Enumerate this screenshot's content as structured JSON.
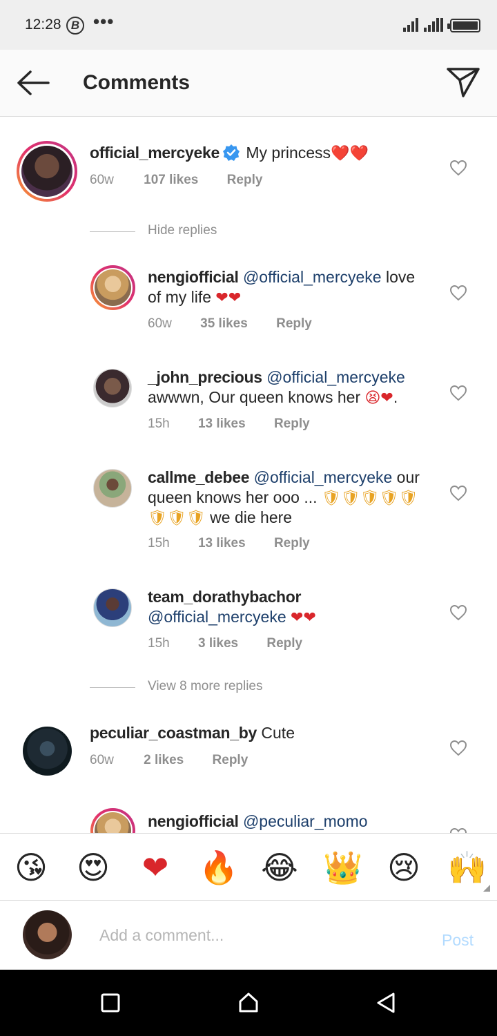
{
  "status_bar": {
    "time": "12:28",
    "b_icon": "B",
    "more_dots": "•••"
  },
  "header": {
    "title": "Comments",
    "back_icon": "arrow-left-icon",
    "send_icon": "paper-plane-icon"
  },
  "comments": [
    {
      "user": "official_mercyeke",
      "verified": true,
      "text": "My princess",
      "emojis": "❤️❤️",
      "time": "60w",
      "likes": "107 likes",
      "reply": "Reply"
    }
  ],
  "hide_replies_label": "Hide replies",
  "replies": [
    {
      "user": "nengiofficial",
      "mention": "@official_mercyeke",
      "text_line1_rest": " love",
      "text_line2": "of my life ",
      "emojis": "❤❤",
      "time": "60w",
      "likes": "35 likes",
      "reply": "Reply"
    },
    {
      "user": "_john_precious",
      "mention": "@official_mercyeke",
      "text_line2": "awwwn, Our queen knows her ",
      "emojis": "😫❤",
      "text_after": ".",
      "time": "15h",
      "likes": "13 likes",
      "reply": "Reply"
    },
    {
      "user": "callme_debee",
      "mention": "@official_mercyeke",
      "text_line1_rest": " our",
      "text_line2": "queen knows her ooo ... ",
      "emojis_line2": "🛡🛡🛡🛡🛡",
      "emojis_line3": "🛡🛡🛡",
      "text_line3": " we die here",
      "time": "15h",
      "likes": "13 likes",
      "reply": "Reply"
    },
    {
      "user": "team_dorathybachor",
      "mention": "@official_mercyeke",
      "emojis": "❤❤",
      "time": "15h",
      "likes": "3 likes",
      "reply": "Reply"
    }
  ],
  "view_more_label": "View 8 more replies",
  "comment2": {
    "user": "peculiar_coastman_by",
    "text": " Cute",
    "time": "60w",
    "likes": "2 likes",
    "reply": "Reply"
  },
  "partial_comment": {
    "user": "nengiofficial",
    "mention": "@peculiar_momo"
  },
  "emoji_bar": [
    {
      "name": "kiss-emoji",
      "glyph": "😘"
    },
    {
      "name": "heart-eyes-emoji",
      "glyph": "😍"
    },
    {
      "name": "red-heart-emoji",
      "glyph": "❤"
    },
    {
      "name": "fire-emoji",
      "glyph": "🔥"
    },
    {
      "name": "tears-of-joy-emoji",
      "glyph": "😂"
    },
    {
      "name": "crown-emoji",
      "glyph": "👑"
    },
    {
      "name": "crying-emoji",
      "glyph": "😢"
    },
    {
      "name": "raising-hands-emoji",
      "glyph": "🙌"
    }
  ],
  "input": {
    "placeholder": "Add a comment...",
    "post_label": "Post"
  },
  "colors": {
    "accent_blue": "#3897f0",
    "mention": "#1d3f6b",
    "meta_gray": "#8e8e8e",
    "post_disabled": "#b3dbff"
  }
}
